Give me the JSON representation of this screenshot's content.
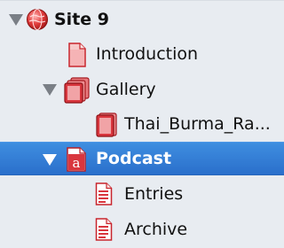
{
  "outline": {
    "items": [
      {
        "label": "Site 9",
        "icon": "site-globe-icon",
        "expanded": true
      },
      {
        "label": "Introduction",
        "icon": "page-icon"
      },
      {
        "label": "Gallery",
        "icon": "photo-album-icon",
        "expanded": true
      },
      {
        "label": "Thai_Burma_Ra...",
        "icon": "photo-album-page-icon"
      },
      {
        "label": "Podcast",
        "icon": "podcast-page-icon",
        "expanded": true,
        "selected": true
      },
      {
        "label": "Entries",
        "icon": "document-text-icon"
      },
      {
        "label": "Archive",
        "icon": "document-text-icon"
      }
    ]
  },
  "colors": {
    "panel_background": "#e8ecf1",
    "selection": "#2f7bd6",
    "icon_red": "#d9363e",
    "disclosure_gray": "#7a7f86"
  }
}
